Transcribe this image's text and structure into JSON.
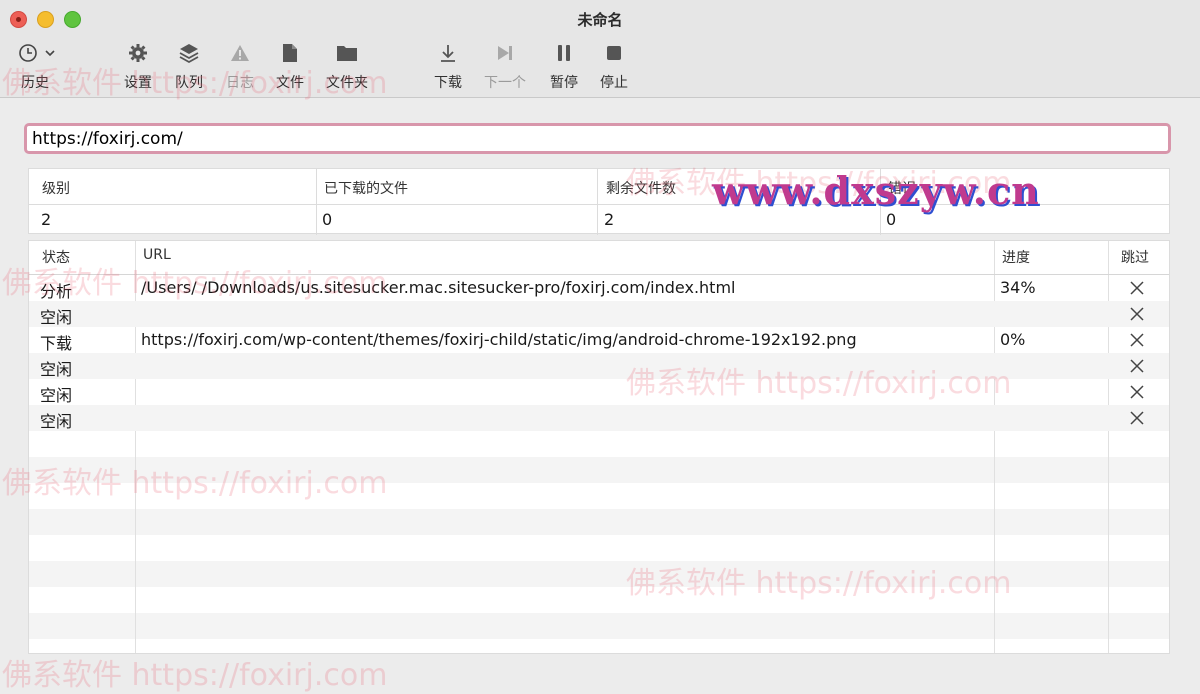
{
  "window": {
    "title": "未命名"
  },
  "toolbar": {
    "history": "历史",
    "settings": "设置",
    "queue": "队列",
    "log": "日志",
    "file": "文件",
    "folder": "文件夹",
    "download": "下载",
    "next": "下一个",
    "pause": "暂停",
    "stop": "停止"
  },
  "url_field": {
    "value": "https://foxirj.com/"
  },
  "stats": {
    "headers": [
      "级别",
      "已下载的文件",
      "剩余文件数",
      "错误"
    ],
    "values": [
      "2",
      "0",
      "2",
      "0"
    ]
  },
  "table": {
    "columns": [
      "状态",
      "URL",
      "进度",
      "跳过"
    ],
    "rows": [
      {
        "status": "分析",
        "url": "/Users/            /Downloads/us.sitesucker.mac.sitesucker-pro/foxirj.com/index.html",
        "progress": "34%"
      },
      {
        "status": "空闲",
        "url": "",
        "progress": ""
      },
      {
        "status": "下载",
        "url": "https://foxirj.com/wp-content/themes/foxirj-child/static/img/android-chrome-192x192.png",
        "progress": "0%"
      },
      {
        "status": "空闲",
        "url": "",
        "progress": ""
      },
      {
        "status": "空闲",
        "url": "",
        "progress": ""
      },
      {
        "status": "空闲",
        "url": "",
        "progress": ""
      }
    ]
  },
  "watermarks": {
    "text": "佛系软件 https://foxirj.com",
    "brand": "www.dxszyw.cn"
  }
}
